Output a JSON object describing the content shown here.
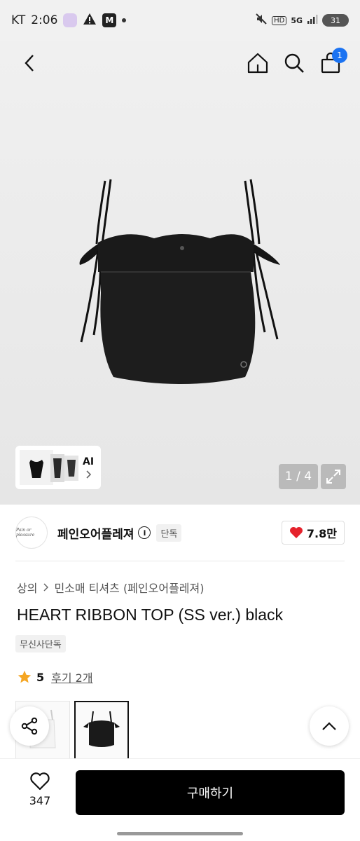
{
  "status_bar": {
    "carrier": "KT",
    "time": "2:06",
    "badge_letter": "M",
    "network": "HD",
    "signal_label": "5G",
    "battery": "31"
  },
  "header": {
    "cart_count": "1"
  },
  "gallery": {
    "ai_label": "AI",
    "counter": "1 / 4"
  },
  "brand": {
    "name": "페인오어플레져",
    "logo_text": "Pain or pleasure",
    "tag": "단독",
    "likes": "7.8만"
  },
  "product": {
    "breadcrumb": [
      "상의",
      "민소매 티셔츠 (페인오어플레져)"
    ],
    "title": "HEART RIBBON TOP (SS ver.) black",
    "tag": "무신사단독",
    "rating": "5",
    "reviews": "후기 2개"
  },
  "bottom_bar": {
    "wishlist_count": "347",
    "buy_label": "구매하기"
  },
  "colors": {
    "accent": "#1b73f2",
    "heart": "#e5222c",
    "star": "#f5a623",
    "primary_button": "#000000"
  }
}
